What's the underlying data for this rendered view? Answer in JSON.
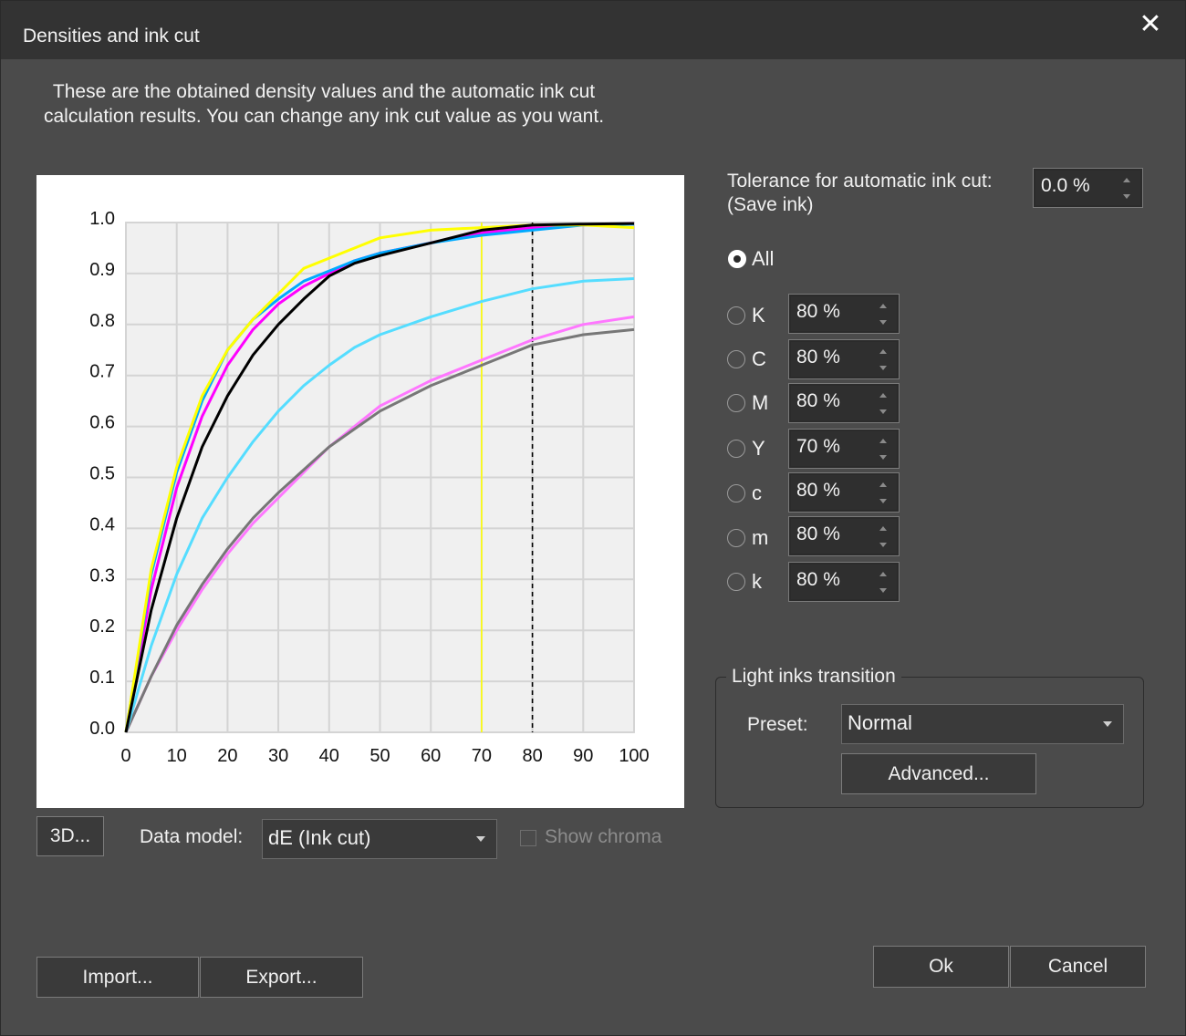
{
  "window": {
    "title": "Densities and ink cut",
    "close_glyph": "✕"
  },
  "description": [
    "These are the obtained density values and the automatic ink cut",
    "calculation results. You can change any ink cut value as you want."
  ],
  "chart_data": {
    "type": "line",
    "xlim": [
      0,
      100
    ],
    "ylim": [
      0,
      1.0
    ],
    "x_ticks": [
      "0",
      "10",
      "20",
      "30",
      "40",
      "50",
      "60",
      "70",
      "80",
      "90",
      "100"
    ],
    "y_ticks": [
      "0.0",
      "0.1",
      "0.2",
      "0.3",
      "0.4",
      "0.5",
      "0.6",
      "0.7",
      "0.8",
      "0.9",
      "1.0"
    ],
    "grid": true,
    "plot_background": "#f0f0f0",
    "x": [
      0,
      5,
      10,
      15,
      20,
      25,
      30,
      35,
      40,
      45,
      50,
      60,
      70,
      80,
      90,
      100
    ],
    "series": [
      {
        "color": "#ffff00",
        "values": [
          0,
          0.32,
          0.52,
          0.66,
          0.75,
          0.81,
          0.86,
          0.91,
          0.93,
          0.95,
          0.97,
          0.985,
          0.99,
          0.995,
          0.995,
          0.99
        ]
      },
      {
        "color": "#00aaff",
        "values": [
          0,
          0.31,
          0.51,
          0.65,
          0.75,
          0.81,
          0.85,
          0.885,
          0.905,
          0.925,
          0.94,
          0.96,
          0.975,
          0.985,
          0.995,
          0.997
        ]
      },
      {
        "color": "#ff00ff",
        "values": [
          0,
          0.28,
          0.48,
          0.62,
          0.72,
          0.79,
          0.84,
          0.875,
          0.9,
          0.925,
          0.94,
          0.96,
          0.98,
          0.99,
          0.995,
          0.998
        ]
      },
      {
        "color": "#000000",
        "values": [
          0,
          0.24,
          0.42,
          0.56,
          0.66,
          0.74,
          0.8,
          0.85,
          0.895,
          0.92,
          0.935,
          0.96,
          0.985,
          0.995,
          0.997,
          0.998
        ]
      },
      {
        "color": "#55ddff",
        "values": [
          0,
          0.17,
          0.31,
          0.42,
          0.5,
          0.57,
          0.63,
          0.68,
          0.72,
          0.755,
          0.78,
          0.815,
          0.845,
          0.87,
          0.885,
          0.89
        ]
      },
      {
        "color": "#ff77ff",
        "values": [
          0,
          0.11,
          0.2,
          0.28,
          0.35,
          0.41,
          0.46,
          0.51,
          0.56,
          0.6,
          0.64,
          0.69,
          0.73,
          0.77,
          0.8,
          0.815
        ]
      },
      {
        "color": "#777777",
        "values": [
          0,
          0.11,
          0.21,
          0.29,
          0.36,
          0.42,
          0.47,
          0.515,
          0.56,
          0.595,
          0.63,
          0.68,
          0.72,
          0.76,
          0.78,
          0.79
        ]
      }
    ],
    "markers": [
      {
        "x": 70,
        "color": "#ffff00",
        "style": "solid"
      },
      {
        "x": 80,
        "color": "#000000",
        "style": "dashed"
      }
    ]
  },
  "controls": {
    "three_d_label": "3D...",
    "data_model_label": "Data model:",
    "data_model_value": "dE (Ink cut)",
    "show_chroma_label": "Show chroma",
    "show_chroma_checked": false
  },
  "tolerance": {
    "label_line1": "Tolerance for automatic ink cut:",
    "label_line2": "(Save ink)",
    "value": "0.0 %"
  },
  "inks": [
    {
      "label": "All",
      "checked": true
    },
    {
      "label": "K",
      "value": "80 %",
      "checked": false
    },
    {
      "label": "C",
      "value": "80 %",
      "checked": false
    },
    {
      "label": "M",
      "value": "80 %",
      "checked": false
    },
    {
      "label": "Y",
      "value": "70 %",
      "checked": false
    },
    {
      "label": "c",
      "value": "80 %",
      "checked": false
    },
    {
      "label": "m",
      "value": "80 %",
      "checked": false
    },
    {
      "label": "k",
      "value": "80 %",
      "checked": false
    }
  ],
  "light_inks": {
    "group_title": "Light inks transition",
    "preset_label": "Preset:",
    "preset_value": "Normal",
    "advanced_label": "Advanced..."
  },
  "footer": {
    "import_label": "Import...",
    "export_label": "Export...",
    "ok_label": "Ok",
    "cancel_label": "Cancel"
  }
}
